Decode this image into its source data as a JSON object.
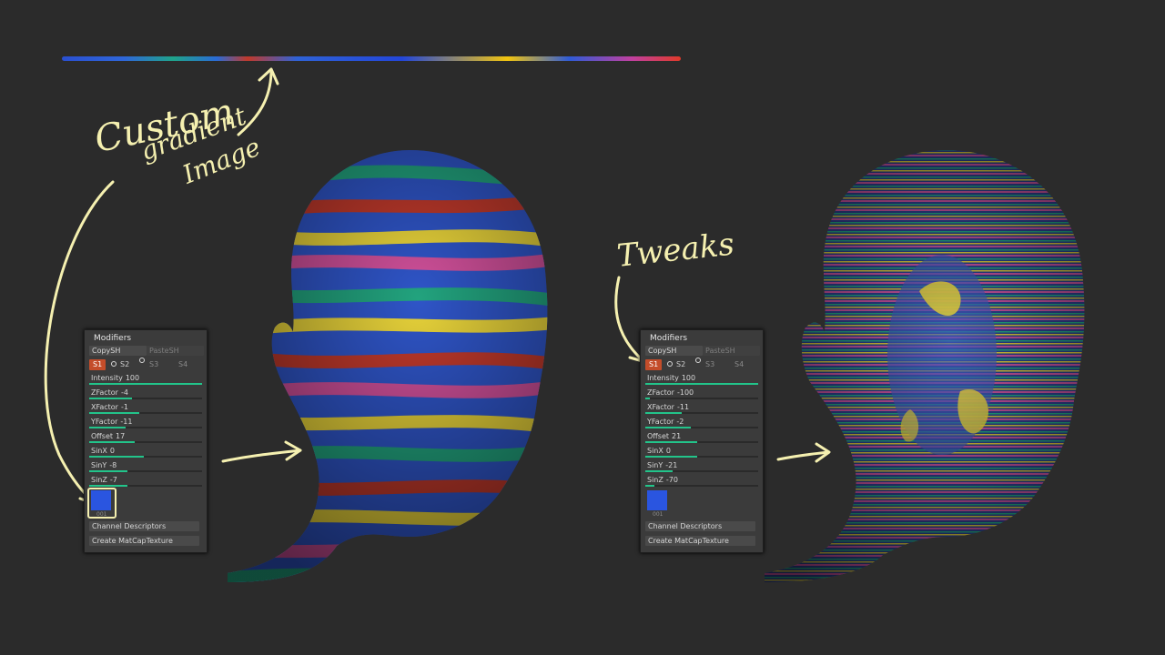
{
  "annotations": {
    "custom": "Custom",
    "gradient": "gradient",
    "image": "Image",
    "tweaks": "Tweaks"
  },
  "colors": {
    "accent_green": "#22c48a",
    "active_tab": "#c44d2a",
    "annotation": "#f5f0b0",
    "swatch": "#2a55e0"
  },
  "panel_left": {
    "title": "Modifiers",
    "copy_label": "CopySH",
    "paste_label": "PasteSH",
    "tabs": [
      "S1",
      "S2",
      "S3",
      "S4"
    ],
    "sliders": [
      {
        "label": "Intensity",
        "value": "100",
        "fill": 1.0
      },
      {
        "label": "ZFactor",
        "value": "-4",
        "fill": 0.38
      },
      {
        "label": "XFactor",
        "value": "-1",
        "fill": 0.44
      },
      {
        "label": "YFactor",
        "value": "-11",
        "fill": 0.32
      },
      {
        "label": "Offset",
        "value": "17",
        "fill": 0.4
      },
      {
        "label": "SinX",
        "value": "0",
        "fill": 0.48
      },
      {
        "label": "SinY",
        "value": "-8",
        "fill": 0.34
      },
      {
        "label": "SinZ",
        "value": "-7",
        "fill": 0.34
      }
    ],
    "swatch_label": "001",
    "channel_label": "Channel Descriptors",
    "create_label": "Create MatCapTexture"
  },
  "panel_right": {
    "title": "Modifiers",
    "copy_label": "CopySH",
    "paste_label": "PasteSH",
    "tabs": [
      "S1",
      "S2",
      "S3",
      "S4"
    ],
    "sliders": [
      {
        "label": "Intensity",
        "value": "100",
        "fill": 1.0
      },
      {
        "label": "ZFactor",
        "value": "-100",
        "fill": 0.04
      },
      {
        "label": "XFactor",
        "value": "-11",
        "fill": 0.32
      },
      {
        "label": "YFactor",
        "value": "-2",
        "fill": 0.4
      },
      {
        "label": "Offset",
        "value": "21",
        "fill": 0.46
      },
      {
        "label": "SinX",
        "value": "0",
        "fill": 0.46
      },
      {
        "label": "SinY",
        "value": "-21",
        "fill": 0.24
      },
      {
        "label": "SinZ",
        "value": "-70",
        "fill": 0.08
      }
    ],
    "swatch_label": "001",
    "channel_label": "Channel Descriptors",
    "create_label": "Create MatCapTexture"
  }
}
